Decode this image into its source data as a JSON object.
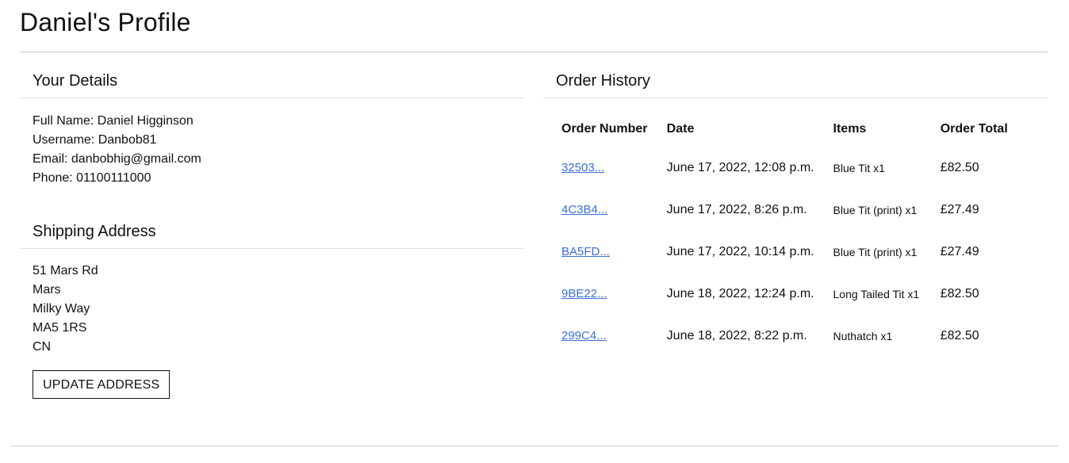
{
  "page": {
    "title": "Daniel's Profile"
  },
  "details": {
    "heading": "Your Details",
    "full_name": "Full Name: Daniel Higginson",
    "username": "Username: Danbob81",
    "email": "Email: danbobhig@gmail.com",
    "phone": "Phone: 01100111000"
  },
  "shipping": {
    "heading": "Shipping Address",
    "lines": [
      "51 Mars Rd",
      "Mars",
      "Milky Way",
      "MA5 1RS",
      "CN"
    ],
    "update_label": "UPDATE ADDRESS"
  },
  "orders": {
    "heading": "Order History",
    "columns": [
      "Order Number",
      "Date",
      "Items",
      "Order Total"
    ],
    "rows": [
      {
        "number": "32503...",
        "date": "June 17, 2022, 12:08 p.m.",
        "items": "Blue Tit x1",
        "total": "£82.50"
      },
      {
        "number": "4C3B4...",
        "date": "June 17, 2022, 8:26 p.m.",
        "items": "Blue Tit (print) x1",
        "total": "£27.49"
      },
      {
        "number": "BA5FD...",
        "date": "June 17, 2022, 10:14 p.m.",
        "items": "Blue Tit (print) x1",
        "total": "£27.49"
      },
      {
        "number": "9BE22...",
        "date": "June 18, 2022, 12:24 p.m.",
        "items": "Long Tailed Tit x1",
        "total": "£82.50"
      },
      {
        "number": "299C4...",
        "date": "June 18, 2022, 8:22 p.m.",
        "items": "Nuthatch x1",
        "total": "£82.50"
      }
    ]
  },
  "colors": {
    "link": "#3a6fd8",
    "text": "#111111",
    "rule": "#c9c9c9"
  }
}
